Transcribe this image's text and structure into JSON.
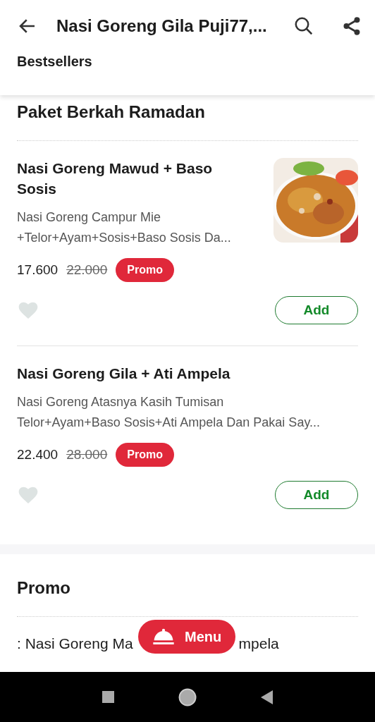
{
  "header": {
    "title": "Nasi Goreng Gila Puji77,...",
    "tab": "Bestsellers"
  },
  "sections": [
    {
      "title": "Paket Berkah Ramadan",
      "items": [
        {
          "name": "Nasi Goreng Mawud + Baso Sosis",
          "description": "Nasi Goreng Campur Mie\n+Telor+Ayam+Sosis+Baso Sosis Da...",
          "price": "17.600",
          "old_price": "22.000",
          "badge": "Promo",
          "liked": false,
          "button": "Add"
        },
        {
          "name": "Nasi  Goreng Gila + Ati Ampela",
          "description": "Nasi Goreng Atasnya Kasih Tumisan\nTelor+Ayam+Baso Sosis+Ati Ampela Dan Pakai Say...",
          "price": "22.400",
          "old_price": "28.000",
          "badge": "Promo",
          "liked": false,
          "button": "Add"
        }
      ]
    },
    {
      "title": "Promo",
      "partial_item": {
        "name_start": ": Nasi Goreng Ma",
        "name_end": "mpela"
      }
    }
  ],
  "floating_button": {
    "label": "Menu"
  }
}
